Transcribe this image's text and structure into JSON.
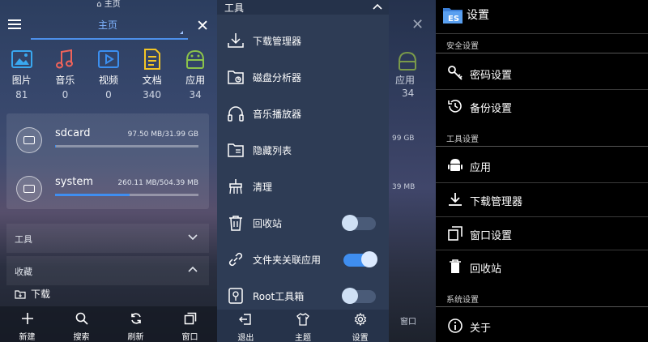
{
  "status_bar": {
    "home_label": "主页"
  },
  "panel1": {
    "tab_title": "主页",
    "categories": [
      {
        "label": "图片",
        "count": "81"
      },
      {
        "label": "音乐",
        "count": "0"
      },
      {
        "label": "视频",
        "count": "0"
      },
      {
        "label": "文档",
        "count": "340"
      },
      {
        "label": "应用",
        "count": "34"
      }
    ],
    "drives": [
      {
        "name": "sdcard",
        "size": "97.50 MB/31.99 GB",
        "used_fraction": 0.003
      },
      {
        "name": "system",
        "size": "260.11 MB/504.39 MB",
        "used_fraction": 0.52
      }
    ],
    "tools_section": "工具",
    "favorites_section": "收藏",
    "favorite_item": "下载",
    "bottom_bar": [
      {
        "label": "新建"
      },
      {
        "label": "搜索"
      },
      {
        "label": "刷新"
      },
      {
        "label": "窗口"
      }
    ]
  },
  "panel2": {
    "title": "工具",
    "tools": [
      {
        "label": "下载管理器"
      },
      {
        "label": "磁盘分析器"
      },
      {
        "label": "音乐播放器"
      },
      {
        "label": "隐藏列表"
      },
      {
        "label": "清理"
      },
      {
        "label": "回收站",
        "toggle": false
      },
      {
        "label": "文件夹关联应用",
        "toggle": true
      },
      {
        "label": "Root工具箱",
        "toggle": false
      }
    ],
    "bottom_bar": [
      {
        "label": "退出"
      },
      {
        "label": "主题"
      },
      {
        "label": "设置"
      }
    ]
  },
  "peek": {
    "app_label": "应用",
    "app_count": "34",
    "size_a": "99 GB",
    "size_b": "39 MB",
    "window_label": "窗口"
  },
  "panel3": {
    "title": "设置",
    "logo_text": "ES",
    "sections": [
      {
        "title": "安全设置",
        "items": [
          {
            "label": "密码设置",
            "icon": "key-icon"
          },
          {
            "label": "备份设置",
            "icon": "history-icon"
          }
        ]
      },
      {
        "title": "工具设置",
        "items": [
          {
            "label": "应用",
            "icon": "android-icon"
          },
          {
            "label": "下载管理器",
            "icon": "download-icon"
          },
          {
            "label": "窗口设置",
            "icon": "window-icon"
          },
          {
            "label": "回收站",
            "icon": "trash-icon"
          }
        ]
      },
      {
        "title": "系统设置",
        "items": [
          {
            "label": "关于",
            "icon": "info-icon"
          }
        ]
      }
    ]
  },
  "colors": {
    "accent": "#3f8ef0",
    "tab_text": "#7fb4ff"
  }
}
